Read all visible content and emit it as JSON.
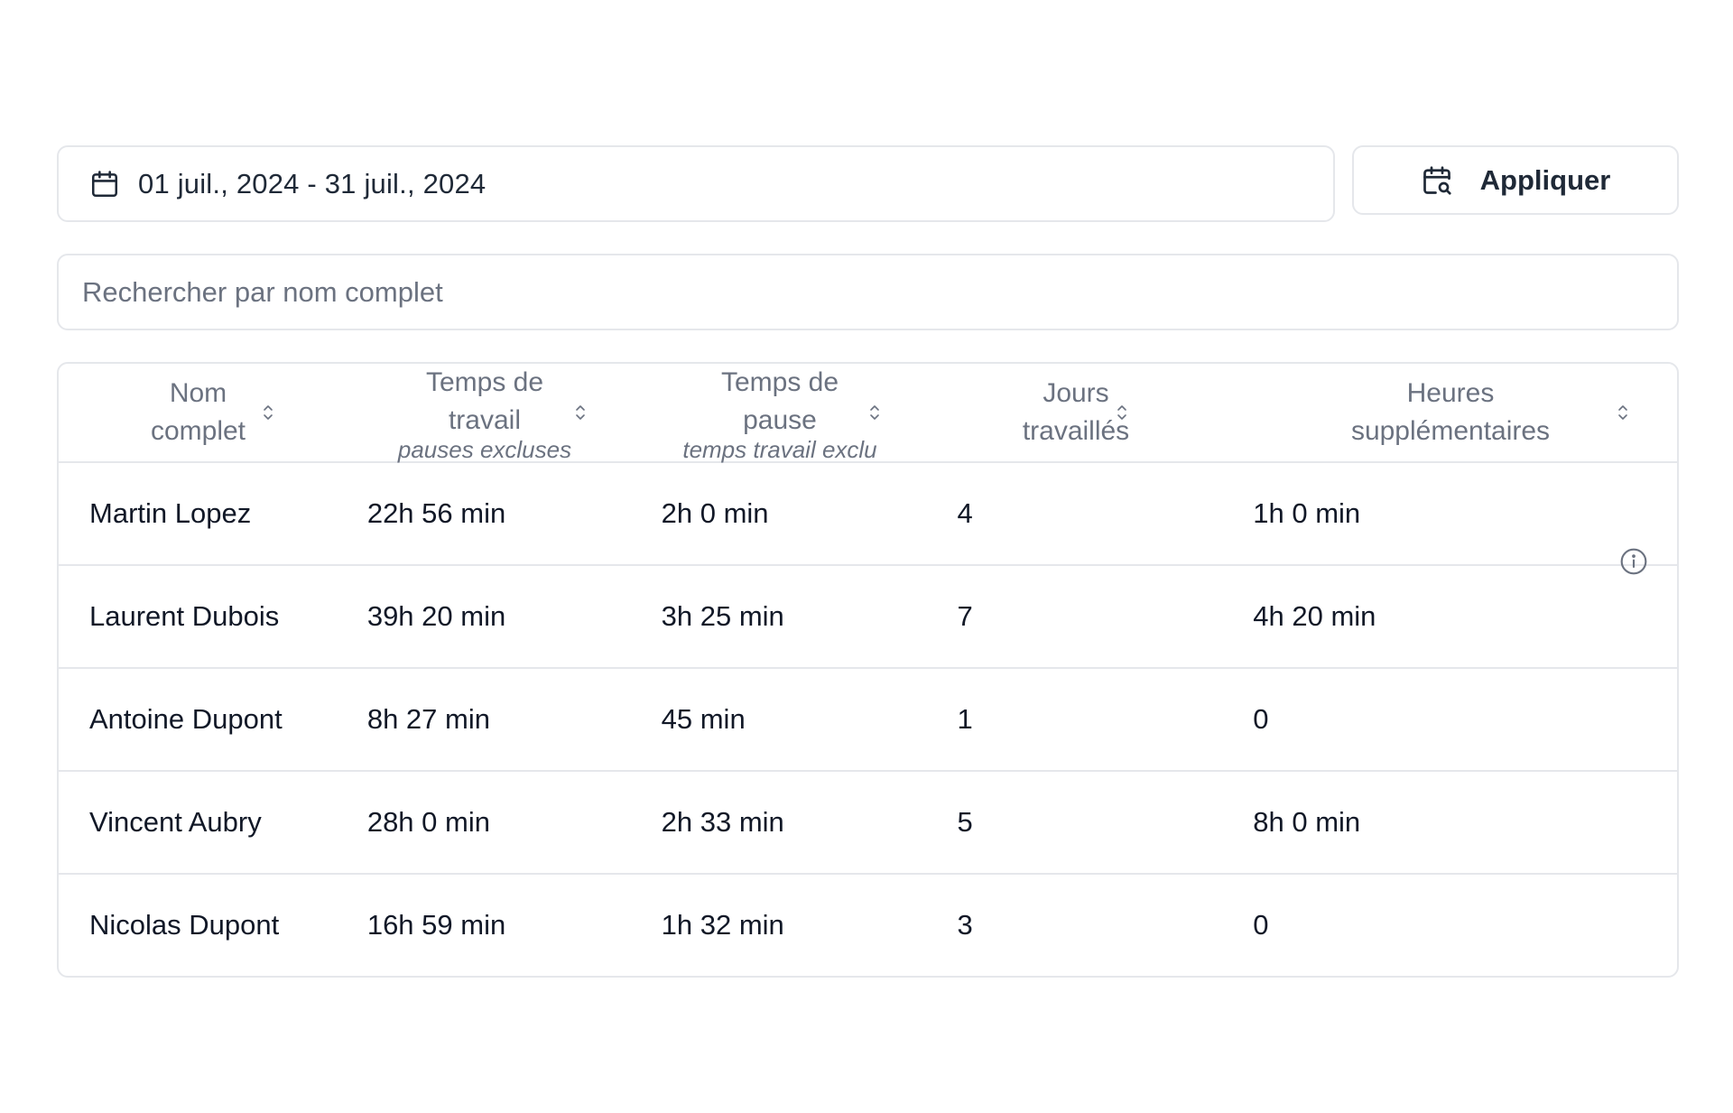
{
  "filters": {
    "date_range": "01 juil., 2024 - 31 juil., 2024",
    "apply_label": "Appliquer",
    "search_placeholder": "Rechercher par nom complet",
    "search_value": ""
  },
  "table": {
    "columns": [
      {
        "label": "Nom\ncomplet",
        "sub": ""
      },
      {
        "label": "Temps de\ntravail",
        "sub": "pauses excluses"
      },
      {
        "label": "Temps de\npause",
        "sub": "temps travail exclu"
      },
      {
        "label": "Jours\ntravaillés",
        "sub": ""
      },
      {
        "label": "Heures\nsupplémentaires",
        "sub": ""
      }
    ],
    "rows": [
      [
        "Martin Lopez",
        "22h 56 min",
        "2h 0 min",
        "4",
        "1h 0 min"
      ],
      [
        "Laurent Dubois",
        "39h 20 min",
        "3h 25 min",
        "7",
        "4h 20 min"
      ],
      [
        "Antoine Dupont",
        "8h 27 min",
        "45 min",
        "1",
        "0"
      ],
      [
        "Vincent Aubry",
        "28h 0 min",
        "2h 33 min",
        "5",
        "8h 0 min"
      ],
      [
        "Nicolas Dupont",
        "16h 59 min",
        "1h 32 min",
        "3",
        "0"
      ]
    ]
  },
  "icons": {
    "calendar": "calendar-icon",
    "calendar_search": "calendar-search-icon",
    "sort": "sort-icon",
    "info": "info-icon"
  }
}
